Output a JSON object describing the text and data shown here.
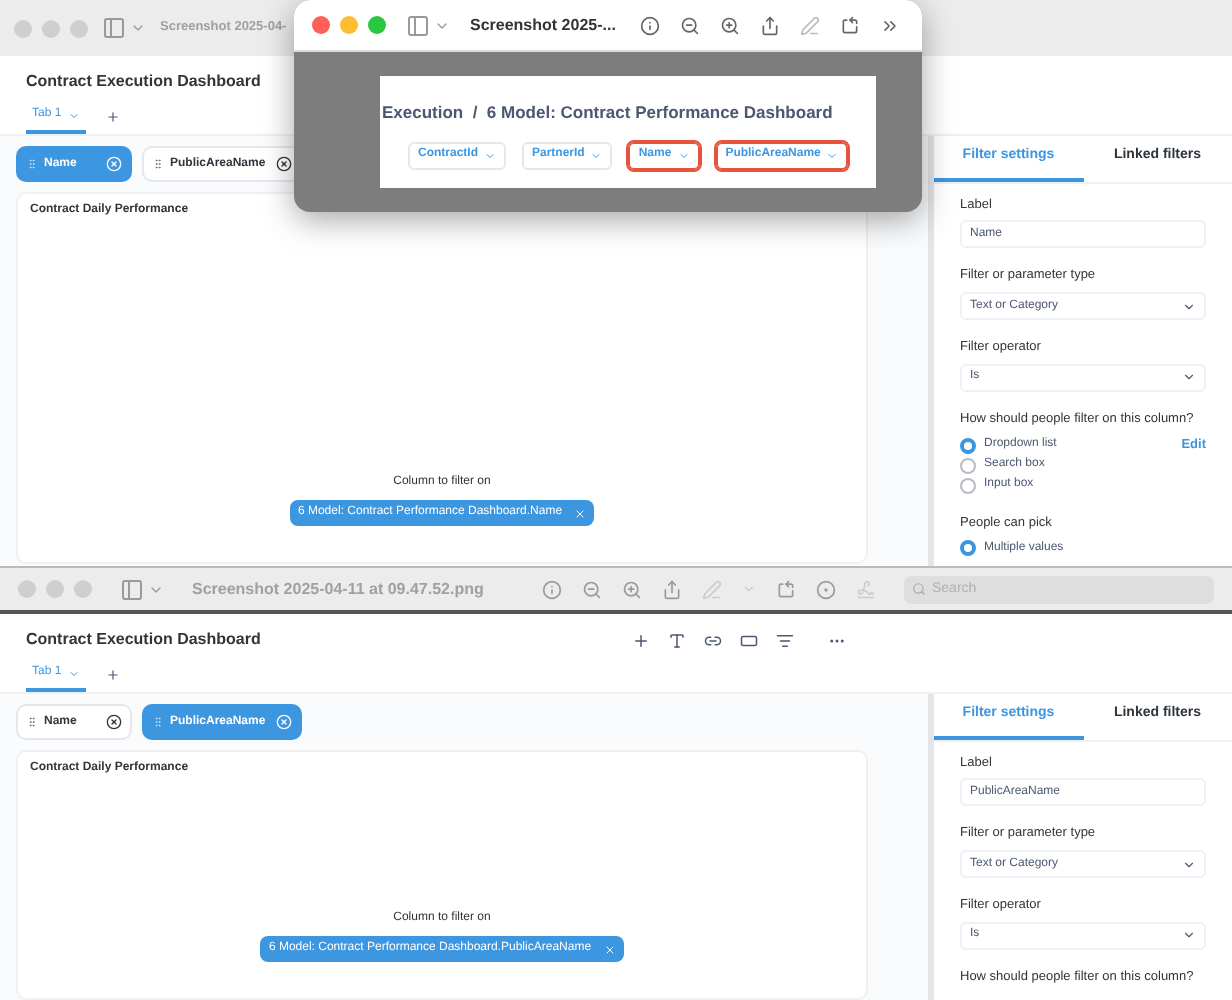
{
  "back_window": {
    "title": "Screenshot 2025-04-",
    "dashboard": {
      "title": "Contract Execution Dashboard",
      "tabs": [
        {
          "label": "Tab 1",
          "selected": true
        }
      ],
      "filters": [
        {
          "label": "Name",
          "selected": true
        },
        {
          "label": "PublicAreaName",
          "selected": false
        }
      ],
      "card_title": "Contract Daily Performance",
      "column_prompt": "Column to filter on",
      "column_chip": "6 Model: Contract Performance Dashboard.Name",
      "panel": {
        "tabs": [
          {
            "label": "Filter settings",
            "selected": true
          },
          {
            "label": "Linked filters",
            "selected": false
          }
        ],
        "label_heading": "Label",
        "label_value": "Name",
        "type_heading": "Filter or parameter type",
        "type_value": "Text or Category",
        "operator_heading": "Filter operator",
        "operator_value": "Is",
        "method_heading": "How should people filter on this column?",
        "methods": [
          {
            "label": "Dropdown list",
            "selected": true
          },
          {
            "label": "Search box",
            "selected": false
          },
          {
            "label": "Input box",
            "selected": false
          }
        ],
        "edit": "Edit",
        "pick_heading": "People can pick",
        "pick_options": [
          {
            "label": "Multiple values",
            "selected": true
          }
        ]
      }
    }
  },
  "preview_window": {
    "title": "Screenshot 2025-...",
    "breadcrumb": "Execution  /  6 Model: Contract Performance Dashboard",
    "chips": [
      {
        "label": "ContractId",
        "highlighted": false
      },
      {
        "label": "PartnerId",
        "highlighted": false
      },
      {
        "label": "Name",
        "highlighted": true
      },
      {
        "label": "PublicAreaName",
        "highlighted": true
      }
    ]
  },
  "front_window": {
    "title": "Screenshot 2025-04-11 at 09.47.52.png",
    "search": {
      "placeholder": "Search"
    },
    "dashboard": {
      "title": "Contract Execution Dashboard",
      "tabs": [
        {
          "label": "Tab 1",
          "selected": true
        }
      ],
      "filters": [
        {
          "label": "Name",
          "selected": false
        },
        {
          "label": "PublicAreaName",
          "selected": true
        }
      ],
      "card_title": "Contract Daily Performance",
      "column_prompt": "Column to filter on",
      "column_chip": "6 Model: Contract Performance Dashboard.PublicAreaName",
      "panel": {
        "tabs": [
          {
            "label": "Filter settings",
            "selected": true
          },
          {
            "label": "Linked filters",
            "selected": false
          }
        ],
        "label_heading": "Label",
        "label_value": "PublicAreaName",
        "type_heading": "Filter or parameter type",
        "type_value": "Text or Category",
        "operator_heading": "Filter operator",
        "operator_value": "Is",
        "method_heading": "How should people filter on this column?"
      }
    }
  }
}
